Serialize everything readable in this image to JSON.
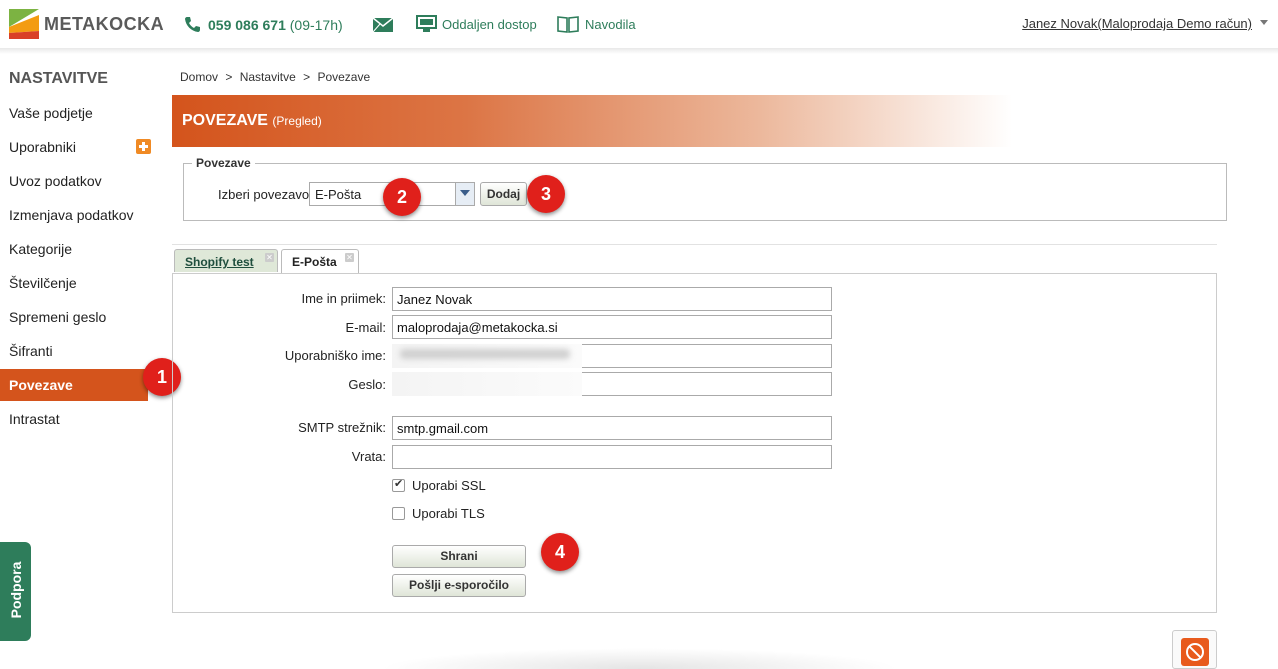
{
  "topbar": {
    "logo_text": "METAKOCKA",
    "phone_number": "059 086 671",
    "phone_hours": "(09-17h)",
    "remote_label": "Oddaljen dostop",
    "guides_label": "Navodila",
    "user_label": "Janez Novak(Maloprodaja Demo račun)"
  },
  "sidebar": {
    "title": "NASTAVITVE",
    "items": [
      {
        "label": "Vaše podjetje"
      },
      {
        "label": "Uporabniki"
      },
      {
        "label": "Uvoz podatkov"
      },
      {
        "label": "Izmenjava podatkov"
      },
      {
        "label": "Kategorije"
      },
      {
        "label": "Številčenje"
      },
      {
        "label": "Spremeni geslo"
      },
      {
        "label": "Šifranti"
      },
      {
        "label": "Povezave"
      },
      {
        "label": "Intrastat"
      }
    ],
    "active_item": "Povezave",
    "support_tab": "Podpora"
  },
  "breadcrumb": [
    "Domov",
    ">",
    "Nastavitve",
    ">",
    "Povezave"
  ],
  "header": {
    "title": "POVEZAVE",
    "subtitle": "(Pregled)"
  },
  "connection_picker": {
    "legend": "Povezave",
    "label": "Izberi povezavo :",
    "selected": "E-Pošta",
    "add_button": "Dodaj"
  },
  "tabs": [
    {
      "label": "Shopify test",
      "active": false
    },
    {
      "label": "E-Pošta",
      "active": true
    }
  ],
  "form": {
    "name_label": "Ime in priimek:",
    "name_value": "Janez Novak",
    "email_label": "E-mail:",
    "email_value": "maloprodaja@metakocka.si",
    "username_label": "Uporabniško ime:",
    "password_label": "Geslo:",
    "smtp_label": "SMTP strežnik:",
    "smtp_value": "smtp.gmail.com",
    "port_label": "Vrata:",
    "port_value": "",
    "ssl_label": "Uporabi SSL",
    "ssl_checked": true,
    "tls_label": "Uporabi TLS",
    "tls_checked": false,
    "save_button": "Shrani",
    "send_button": "Pošlji e-sporočilo"
  },
  "markers": [
    "1",
    "2",
    "3",
    "4"
  ],
  "colors": {
    "accent": "#d4541c",
    "brand_green": "#2e7d5b",
    "marker_red": "#e0201b"
  }
}
